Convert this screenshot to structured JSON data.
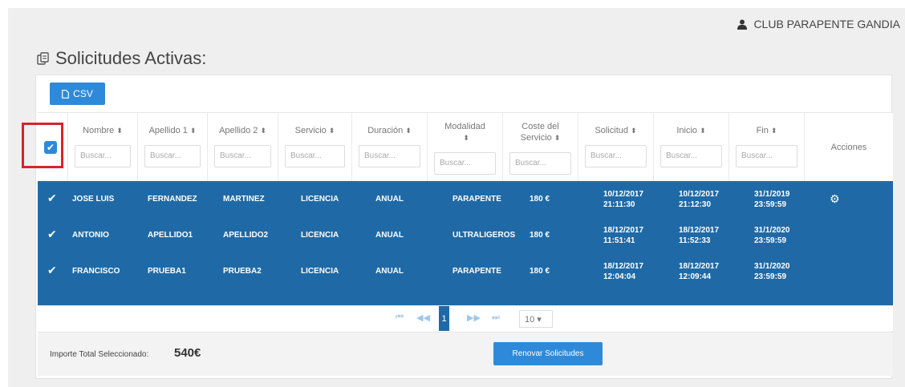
{
  "header": {
    "club_name": "CLUB PARAPENTE GANDIA",
    "user_icon": "user-icon"
  },
  "page": {
    "title": "Solicitudes Activas:",
    "title_icon": "requests-icon"
  },
  "toolbar": {
    "csv_label": "CSV",
    "csv_icon": "file-icon"
  },
  "table": {
    "search_placeholder": "Buscar...",
    "columns": [
      {
        "label": "Nombre",
        "sort": "⬍"
      },
      {
        "label": "Apellido 1",
        "sort": "⬍"
      },
      {
        "label": "Apellido 2",
        "sort": "⬍"
      },
      {
        "label": "Servicio",
        "sort": "⬍"
      },
      {
        "label": "Duración",
        "sort": "⬍"
      },
      {
        "label": "Modalidad",
        "sort": "⬍"
      },
      {
        "label": "Coste del Servicio",
        "sort": "⬍"
      },
      {
        "label": "Solicitud",
        "sort": "⬍"
      },
      {
        "label": "Inicio",
        "sort": "⬍"
      },
      {
        "label": "Fin",
        "sort": "⬍"
      },
      {
        "label": "Acciones"
      }
    ],
    "rows": [
      {
        "selected": true,
        "nombre": "JOSE LUIS",
        "apellido1": "FERNANDEZ",
        "apellido2": "MARTINEZ",
        "servicio": "LICENCIA",
        "duracion": "ANUAL",
        "modalidad": "PARAPENTE",
        "coste": "180 €",
        "solicitud_fecha": "10/12/2017",
        "solicitud_hora": "21:11:30",
        "inicio_fecha": "10/12/2017",
        "inicio_hora": "21:12:30",
        "fin_fecha": "31/1/2019",
        "fin_hora": "23:59:59",
        "action_icon": "gear-icon"
      },
      {
        "selected": true,
        "nombre": "ANTONIO",
        "apellido1": "APELLIDO1",
        "apellido2": "APELLIDO2",
        "servicio": "LICENCIA",
        "duracion": "ANUAL",
        "modalidad": "ULTRALIGEROS",
        "coste": "180 €",
        "solicitud_fecha": "18/12/2017",
        "solicitud_hora": "11:51:41",
        "inicio_fecha": "18/12/2017",
        "inicio_hora": "11:52:33",
        "fin_fecha": "31/1/2020",
        "fin_hora": "23:59:59"
      },
      {
        "selected": true,
        "nombre": "FRANCISCO",
        "apellido1": "PRUEBA1",
        "apellido2": "PRUEBA2",
        "servicio": "LICENCIA",
        "duracion": "ANUAL",
        "modalidad": "PARAPENTE",
        "coste": "180 €",
        "solicitud_fecha": "18/12/2017",
        "solicitud_hora": "12:04:04",
        "inicio_fecha": "18/12/2017",
        "inicio_hora": "12:09:44",
        "fin_fecha": "31/1/2020",
        "fin_hora": "23:59:59"
      }
    ]
  },
  "pagination": {
    "first": "⏮",
    "prev": "◀◀",
    "current_page": "1",
    "next": "▶▶",
    "last": "⏭",
    "page_size": "10 ▾"
  },
  "footer": {
    "total_label": "Importe Total Seleccionado:",
    "total_value": "540€",
    "renew_label": "Renovar Solicitudes"
  },
  "colors": {
    "primary": "#2e8ad8",
    "selected_row": "#1f6aa6",
    "highlight": "#d8232a"
  }
}
